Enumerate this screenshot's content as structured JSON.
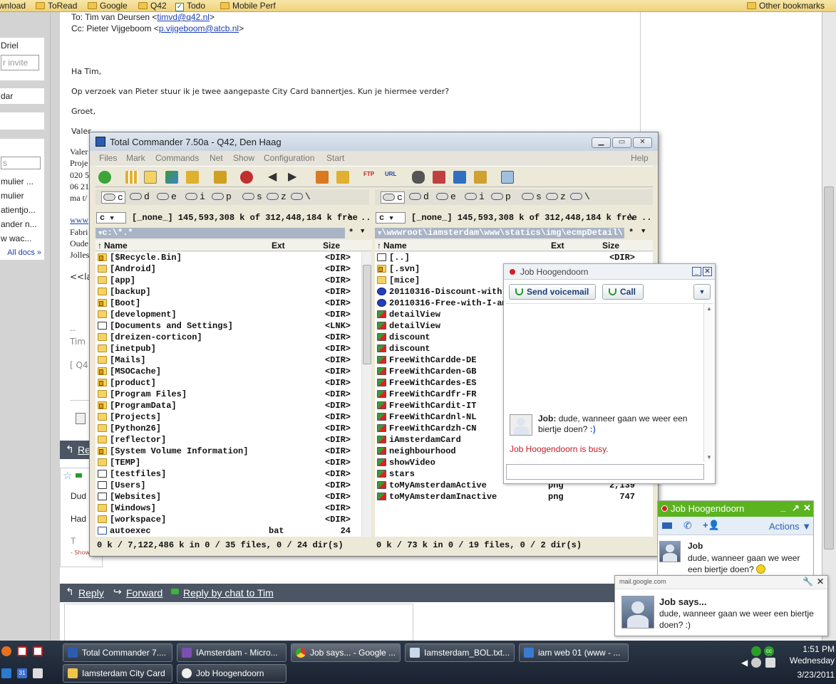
{
  "bookmarks": {
    "items": [
      {
        "label": "wnload",
        "icon": "none"
      },
      {
        "label": "ToRead",
        "icon": "folder-icon"
      },
      {
        "label": "Google",
        "icon": "folder-icon"
      },
      {
        "label": "Q42",
        "icon": "folder-icon"
      },
      {
        "label": "Todo",
        "icon": "check-icon"
      },
      {
        "label": "Mobile Perf",
        "icon": "folder-icon"
      }
    ],
    "other": "Other bookmarks"
  },
  "left_sidebar": {
    "contact_name": "Driel",
    "invite_placeholder": "r invite",
    "calendar": "dar",
    "search_placeholder": "s",
    "docs": [
      "mulier ...",
      "mulier",
      "atientjo...",
      "ander n...",
      "w wac..."
    ],
    "all_docs": "All docs »"
  },
  "email": {
    "to_line": "To: Tim van Deursen <",
    "to_email": "timvd@q42.nl",
    "to_end": ">",
    "cc_prefix": "Cc: Pieter Vijgeboom <",
    "cc_email": "p.vijgeboom@atcb.nl",
    "cc_end": ">",
    "greeting": "Ha Tim,",
    "body": "Op verzoek van Pieter stuur ik je twee aangepaste City Card bannertjes. Kun je hiermee verder?",
    "closing": "Groet,",
    "sig": [
      "Valer",
      "Valer",
      "Proje",
      "020 5",
      "06 21",
      "ma t/"
    ],
    "sig_link": "www",
    "addr": [
      "Fabri",
      "Oude",
      "Jolles"
    ],
    "attach": "<<la",
    "dashes": "--",
    "tim": "Tim",
    "q4": "[ Q4",
    "reply_label": "Re",
    "msg2_line1": "Dud",
    "msg2_line2": "Had",
    "msg2_line3": "T",
    "msg2_show": "- Show",
    "reply_bar": {
      "reply": "Reply",
      "forward": "Forward",
      "chat": "Reply by chat to Tim"
    }
  },
  "tc": {
    "title": "Total Commander 7.50a - Q42, Den Haag",
    "menu": [
      "Files",
      "Mark",
      "Commands",
      "Net",
      "Show",
      "Configuration",
      "Start"
    ],
    "help": "Help",
    "drives": [
      "c",
      "d",
      "e",
      "i",
      "p",
      "s",
      "z",
      "\\"
    ],
    "left": {
      "drive": "c",
      "info": "[_none_]  145,593,308 k of 312,448,184 k free",
      "root": "\\",
      "up": "..",
      "path": "c:\\*.*",
      "star": "*",
      "cols": {
        "name": "Name",
        "ext": "Ext",
        "size": "Size"
      },
      "files": [
        {
          "name": "[$Recycle.Bin]",
          "ext": "",
          "size": "<DIR>",
          "icon": "lock"
        },
        {
          "name": "[Android]",
          "ext": "",
          "size": "<DIR>",
          "icon": "folder"
        },
        {
          "name": "[app]",
          "ext": "",
          "size": "<DIR>",
          "icon": "folder"
        },
        {
          "name": "[backup]",
          "ext": "",
          "size": "<DIR>",
          "icon": "folder"
        },
        {
          "name": "[Boot]",
          "ext": "",
          "size": "<DIR>",
          "icon": "lock"
        },
        {
          "name": "[development]",
          "ext": "",
          "size": "<DIR>",
          "icon": "folder"
        },
        {
          "name": "[Documents and Settings]",
          "ext": "",
          "size": "<LNK>",
          "icon": "lnk"
        },
        {
          "name": "[dreizen-corticon]",
          "ext": "",
          "size": "<DIR>",
          "icon": "folder"
        },
        {
          "name": "[inetpub]",
          "ext": "",
          "size": "<DIR>",
          "icon": "folder"
        },
        {
          "name": "[Mails]",
          "ext": "",
          "size": "<DIR>",
          "icon": "folder"
        },
        {
          "name": "[MSOCache]",
          "ext": "",
          "size": "<DIR>",
          "icon": "lock"
        },
        {
          "name": "[product]",
          "ext": "",
          "size": "<DIR>",
          "icon": "lock"
        },
        {
          "name": "[Program Files]",
          "ext": "",
          "size": "<DIR>",
          "icon": "folder"
        },
        {
          "name": "[ProgramData]",
          "ext": "",
          "size": "<DIR>",
          "icon": "lock"
        },
        {
          "name": "[Projects]",
          "ext": "",
          "size": "<DIR>",
          "icon": "folder"
        },
        {
          "name": "[Python26]",
          "ext": "",
          "size": "<DIR>",
          "icon": "folder"
        },
        {
          "name": "[reflector]",
          "ext": "",
          "size": "<DIR>",
          "icon": "folder"
        },
        {
          "name": "[System Volume Information]",
          "ext": "",
          "size": "<DIR>",
          "icon": "lock"
        },
        {
          "name": "[TEMP]",
          "ext": "",
          "size": "<DIR>",
          "icon": "folder"
        },
        {
          "name": "[testfiles]",
          "ext": "",
          "size": "<DIR>",
          "icon": "lnk"
        },
        {
          "name": "[Users]",
          "ext": "",
          "size": "<DIR>",
          "icon": "lnk"
        },
        {
          "name": "[Websites]",
          "ext": "",
          "size": "<DIR>",
          "icon": "lnk"
        },
        {
          "name": "[Windows]",
          "ext": "",
          "size": "<DIR>",
          "icon": "folder"
        },
        {
          "name": "[workspace]",
          "ext": "",
          "size": "<DIR>",
          "icon": "folder"
        },
        {
          "name": "autoexec",
          "ext": "bat",
          "size": "24",
          "icon": "file"
        }
      ],
      "status": "0 k / 7,122,486 k in 0 / 35 files, 0 / 24 dir(s)"
    },
    "right": {
      "drive": "c",
      "info": "[_none_]  145,593,308 k of 312,448,184 k free",
      "root": "\\",
      "up": "..",
      "path": "\\wwwroot\\iamsterdam\\www\\statics\\img\\ecmpDetail\\*.*",
      "star": "*",
      "cols": {
        "name": "Name",
        "ext": "Ext",
        "size": "Size"
      },
      "files": [
        {
          "name": "[..]",
          "ext": "",
          "size": "<DIR>",
          "icon": "up"
        },
        {
          "name": "[.svn]",
          "ext": "",
          "size": "",
          "icon": "lock"
        },
        {
          "name": "[mice]",
          "ext": "",
          "size": "",
          "icon": "folder"
        },
        {
          "name": "20110316-Discount-with-I-am",
          "ext": "",
          "size": "",
          "icon": "q"
        },
        {
          "name": "20110316-Free-with-I-amster",
          "ext": "",
          "size": "",
          "icon": "q"
        },
        {
          "name": "detailView",
          "ext": "",
          "size": "",
          "icon": "img"
        },
        {
          "name": "detailView",
          "ext": "",
          "size": "",
          "icon": "img"
        },
        {
          "name": "discount",
          "ext": "",
          "size": "",
          "icon": "img"
        },
        {
          "name": "discount",
          "ext": "",
          "size": "",
          "icon": "img"
        },
        {
          "name": "FreeWithCardde-DE",
          "ext": "",
          "size": "",
          "icon": "img"
        },
        {
          "name": "FreeWithCarden-GB",
          "ext": "",
          "size": "",
          "icon": "img"
        },
        {
          "name": "FreeWithCardes-ES",
          "ext": "",
          "size": "",
          "icon": "img"
        },
        {
          "name": "FreeWithCardfr-FR",
          "ext": "",
          "size": "",
          "icon": "img"
        },
        {
          "name": "FreeWithCardit-IT",
          "ext": "",
          "size": "",
          "icon": "img"
        },
        {
          "name": "FreeWithCardnl-NL",
          "ext": "",
          "size": "",
          "icon": "img"
        },
        {
          "name": "FreeWithCardzh-CN",
          "ext": "",
          "size": "",
          "icon": "img"
        },
        {
          "name": "iAmsterdamCard",
          "ext": "",
          "size": "",
          "icon": "img"
        },
        {
          "name": "neighbourhood",
          "ext": "",
          "size": "",
          "icon": "img"
        },
        {
          "name": "showVideo",
          "ext": "",
          "size": "",
          "icon": "img"
        },
        {
          "name": "stars",
          "ext": "",
          "size": "",
          "icon": "img"
        },
        {
          "name": "toMyAmsterdamActive",
          "ext": "png",
          "size": "2,139",
          "icon": "img"
        },
        {
          "name": "toMyAmsterdamInactive",
          "ext": "png",
          "size": "747",
          "icon": "img"
        }
      ],
      "status": "0 k / 73 k in 0 / 19 files, 0 / 2 dir(s)"
    }
  },
  "chat_popup": {
    "title": "Job Hoogendoorn",
    "voicemail": "Send voicemail",
    "call": "Call",
    "sender": "Job:",
    "message": "dude, wanneer gaan we weer een biertje doen?",
    "smiley": ":)",
    "status": "Job Hoogendoorn is busy.",
    "status_color": "#c0202a"
  },
  "gtalk": {
    "title": "Job Hoogendoorn",
    "actions": "Actions",
    "sender": "Job",
    "message": "dude, wanneer gaan we weer een biertje doen?",
    "header_color": "#5bb31f"
  },
  "notification": {
    "source": "mail.google.com",
    "title": "Job says...",
    "message": "dude, wanneer gaan we weer een biertje doen? :)"
  },
  "taskbar": {
    "row1": [
      "Total Commander 7....",
      "IAmsterdam - Micro...",
      "Job says... - Google ...",
      "Iamsterdam_BOL.txt...",
      "iam web 01 (www - ..."
    ],
    "row2": [
      "Iamsterdam City Card",
      "Job Hoogendoorn"
    ],
    "time": "1:51 PM",
    "day": "Wednesday",
    "date": "3/23/2011"
  }
}
